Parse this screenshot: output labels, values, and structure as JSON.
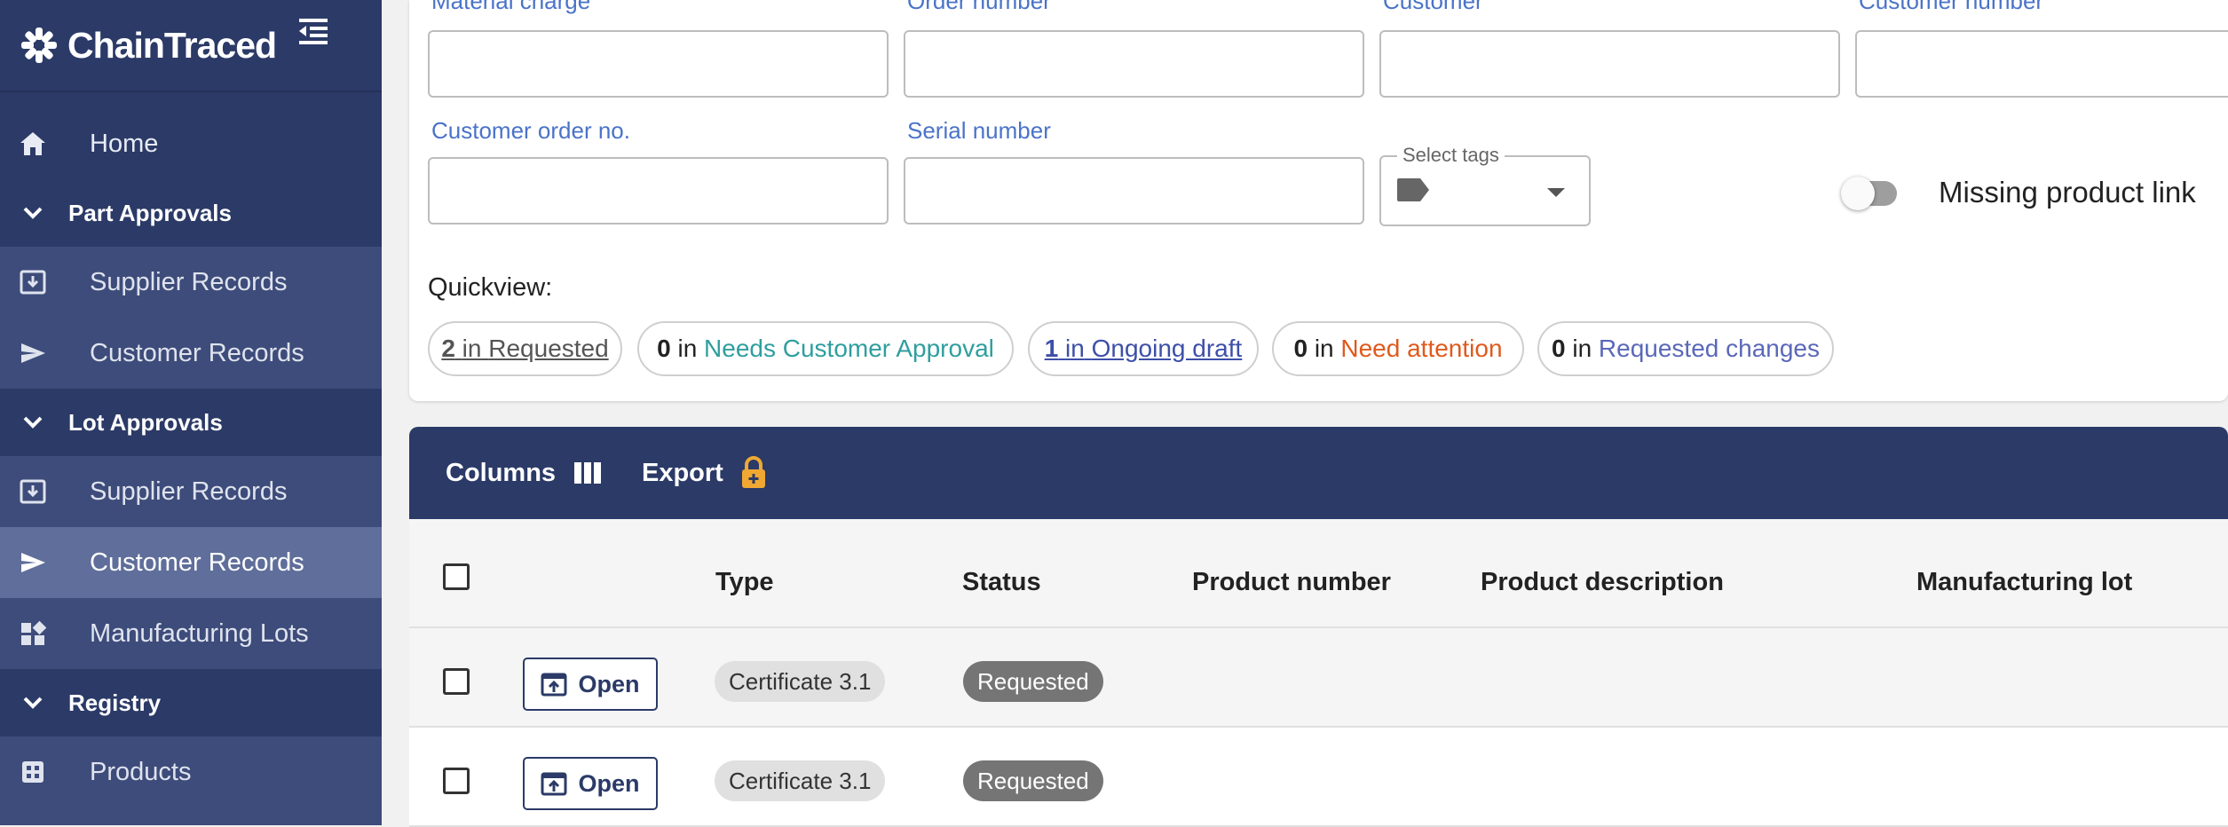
{
  "app": {
    "name": "ChainTraced"
  },
  "sidebar": {
    "items": [
      {
        "label": "Home",
        "icon": "home-icon"
      },
      {
        "label": "Part Approvals",
        "icon": "chevron-down-icon"
      },
      {
        "label": "Supplier Records",
        "icon": "download-box-icon"
      },
      {
        "label": "Customer Records",
        "icon": "send-icon"
      },
      {
        "label": "Lot Approvals",
        "icon": "chevron-down-icon"
      },
      {
        "label": "Supplier Records",
        "icon": "download-box-icon"
      },
      {
        "label": "Customer Records",
        "icon": "send-icon",
        "active": true
      },
      {
        "label": "Manufacturing Lots",
        "icon": "dashboard-icon"
      },
      {
        "label": "Registry",
        "icon": "chevron-down-icon"
      },
      {
        "label": "Products",
        "icon": "grid-box-icon"
      }
    ]
  },
  "filters": {
    "material_charge": "Material charge",
    "order_number": "Order number",
    "customer": "Customer",
    "customer_number": "Customer number",
    "customer_order_no": "Customer order no.",
    "serial_number": "Serial number",
    "select_tags": "Select tags",
    "missing_product_link": "Missing product link"
  },
  "quickview": {
    "label": "Quickview:",
    "in_word": "in",
    "chips": [
      {
        "count": "2",
        "label": "Requested",
        "color": "#555555",
        "underline": true
      },
      {
        "count": "0",
        "label": "Needs Customer Approval",
        "color": "#2f9e9e",
        "underline": false
      },
      {
        "count": "1",
        "label": "Ongoing draft",
        "color": "#3d4fa8",
        "underline": true
      },
      {
        "count": "0",
        "label": "Need attention",
        "color": "#e05a1c",
        "underline": false
      },
      {
        "count": "0",
        "label": "Requested changes",
        "color": "#5a68b8",
        "underline": false
      }
    ]
  },
  "table": {
    "toolbar": {
      "columns": "Columns",
      "export": "Export"
    },
    "headers": [
      "Type",
      "Status",
      "Product number",
      "Product description",
      "Manufacturing lot"
    ],
    "rows": [
      {
        "action": "Open",
        "type": "Certificate 3.1",
        "status": "Requested"
      },
      {
        "action": "Open",
        "type": "Certificate 3.1",
        "status": "Requested"
      }
    ]
  },
  "colors": {
    "sidebar": "#2b3a67",
    "label_blue": "#4a73c8",
    "export_lock": "#f0a832"
  }
}
